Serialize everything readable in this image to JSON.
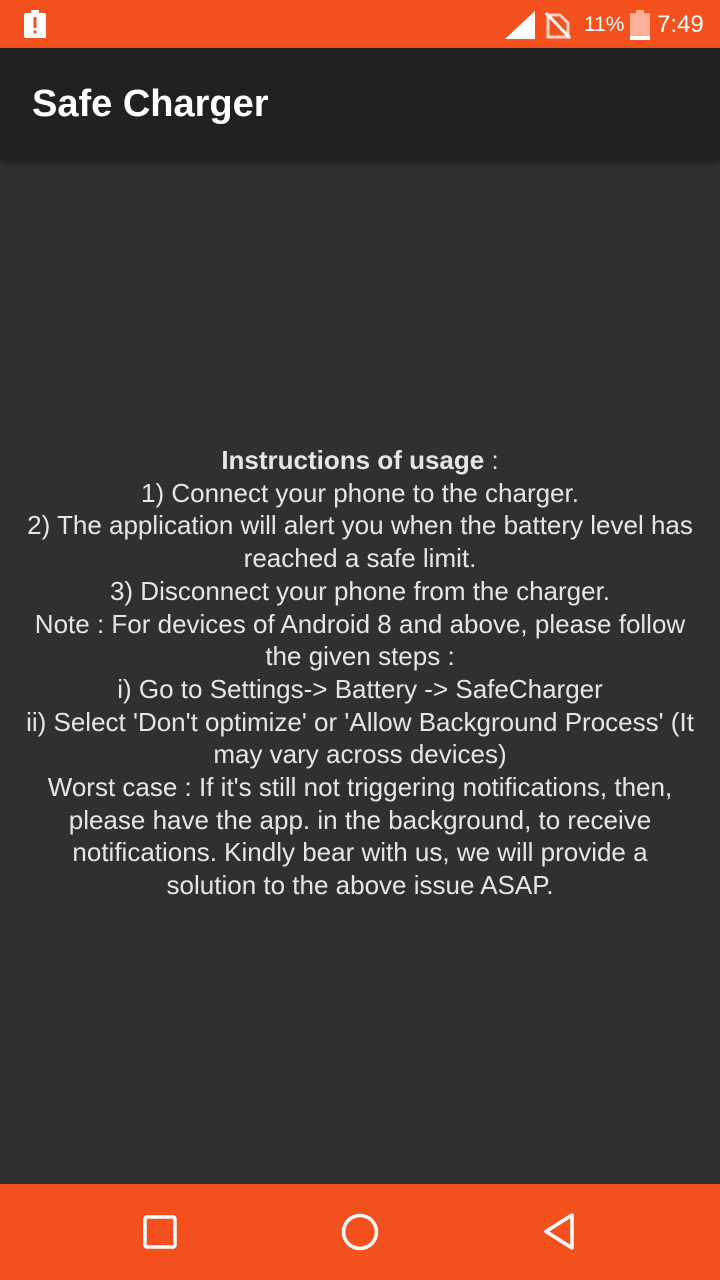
{
  "status_bar": {
    "battery_percent": "11%",
    "time": "7:49",
    "icons": [
      "battery-alert-icon",
      "signal-icon",
      "no-sim-icon",
      "battery-icon"
    ]
  },
  "app_bar": {
    "title": "Safe Charger"
  },
  "instructions": {
    "heading": "Instructions of usage",
    "heading_suffix": " :",
    "lines": [
      "1) Connect your phone to the charger.",
      "2) The application will alert you when the battery level has",
      "reached a safe limit.",
      "3) Disconnect your phone from the charger.",
      "Note : For devices of Android 8 and above, please follow",
      "the given steps :",
      "i) Go to Settings-> Battery -> SafeCharger",
      "ii) Select 'Don't optimize' or 'Allow Background Process' (It",
      "may vary across devices)",
      "Worst case : If it's still not triggering notifications, then,",
      "please have the app. in the background, to receive",
      "notifications. Kindly bear with us, we will provide a",
      "solution to the above issue ASAP."
    ]
  },
  "nav_bar": {
    "buttons": [
      "recents-icon",
      "home-icon",
      "back-icon"
    ]
  },
  "colors": {
    "accent": "#f4511e",
    "app_bar": "#212121",
    "background": "#303030",
    "text": "#e6e6e6"
  }
}
